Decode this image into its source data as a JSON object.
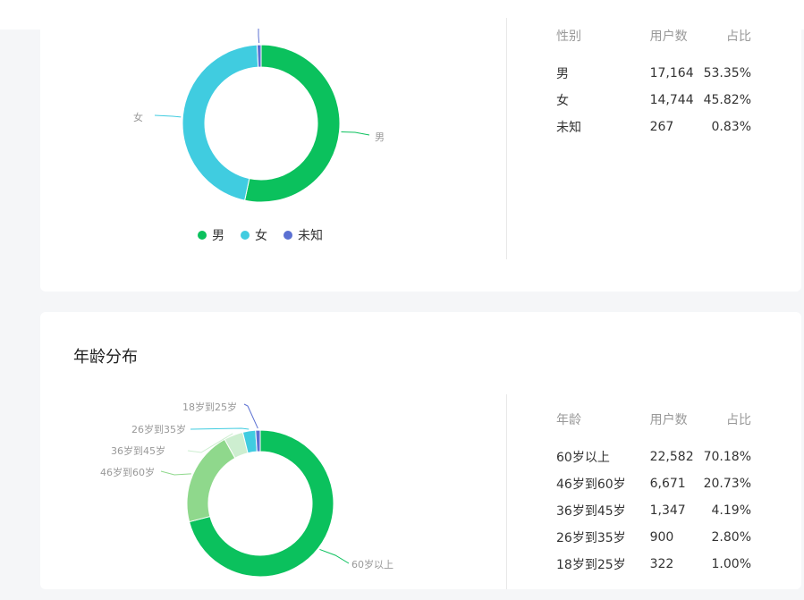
{
  "gender": {
    "table": {
      "headers": [
        "性别",
        "用户数",
        "占比"
      ],
      "rows": [
        {
          "label": "男",
          "count": "17,164",
          "pct": "53.35%"
        },
        {
          "label": "女",
          "count": "14,744",
          "pct": "45.82%"
        },
        {
          "label": "未知",
          "count": "267",
          "pct": "0.83%"
        }
      ]
    },
    "legend": [
      {
        "label": "男",
        "color": "#0bc15d"
      },
      {
        "label": "女",
        "color": "#40cce0"
      },
      {
        "label": "未知",
        "color": "#5b70d2"
      }
    ]
  },
  "age": {
    "title": "年龄分布",
    "table": {
      "headers": [
        "年龄",
        "用户数",
        "占比"
      ],
      "rows": [
        {
          "label": "60岁以上",
          "count": "22,582",
          "pct": "70.18%"
        },
        {
          "label": "46岁到60岁",
          "count": "6,671",
          "pct": "20.73%"
        },
        {
          "label": "36岁到45岁",
          "count": "1,347",
          "pct": "4.19%"
        },
        {
          "label": "26岁到35岁",
          "count": "900",
          "pct": "2.80%"
        },
        {
          "label": "18岁到25岁",
          "count": "322",
          "pct": "1.00%"
        }
      ]
    }
  },
  "chart_data": [
    {
      "type": "pie",
      "categories": [
        "男",
        "女",
        "未知"
      ],
      "values": [
        17164,
        14744,
        267
      ],
      "colors": [
        "#0bc15d",
        "#40cce0",
        "#5b70d2"
      ],
      "legend": "bottom"
    },
    {
      "type": "pie",
      "title": "年龄分布",
      "categories": [
        "60岁以上",
        "46岁到60岁",
        "36岁到45岁",
        "26岁到35岁",
        "18岁到25岁"
      ],
      "values": [
        22582,
        6671,
        1347,
        900,
        322
      ],
      "colors": [
        "#0bc15d",
        "#8fd88c",
        "#cdeed0",
        "#40cce0",
        "#5b70d2"
      ]
    }
  ]
}
